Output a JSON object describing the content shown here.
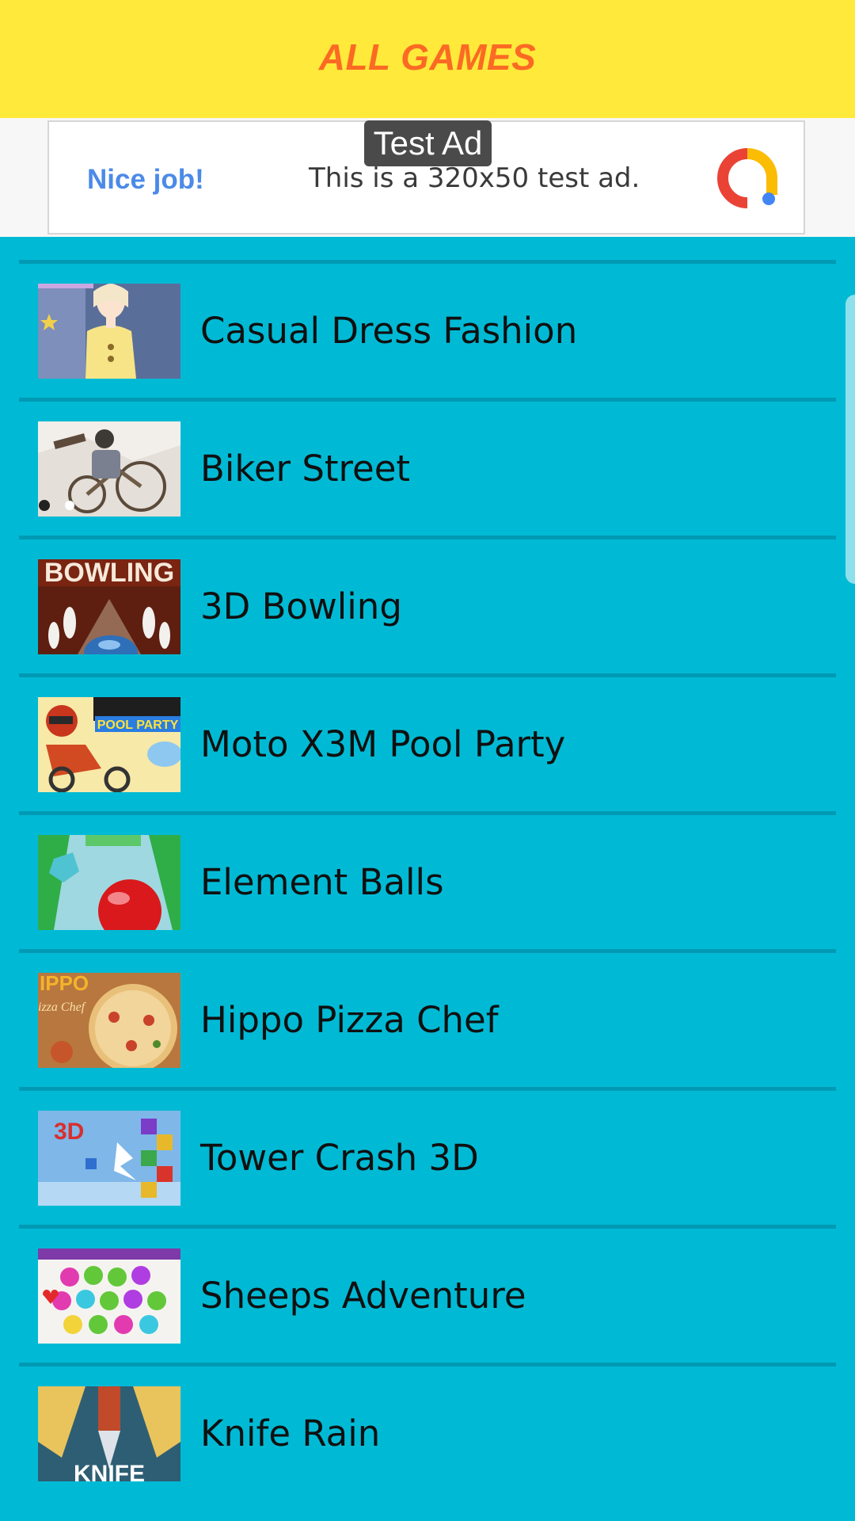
{
  "header": {
    "title": "ALL GAMES"
  },
  "ad": {
    "label": "Test Ad",
    "headline": "Nice job!",
    "text": "This is a 320x50 test ad.",
    "logo_icon": "admob-icon",
    "colors": {
      "headline": "#4B8AE8",
      "logo_red": "#EA4335",
      "logo_yellow": "#FBBC04",
      "logo_blue": "#4285F4"
    }
  },
  "games": [
    {
      "title": "Casual Dress Fashion",
      "thumb_icon": "dress-fashion-thumbnail"
    },
    {
      "title": "Biker Street",
      "thumb_icon": "biker-street-thumbnail"
    },
    {
      "title": "3D Bowling",
      "thumb_icon": "bowling-thumbnail"
    },
    {
      "title": "Moto X3M Pool Party",
      "thumb_icon": "moto-pool-party-thumbnail"
    },
    {
      "title": "Element Balls",
      "thumb_icon": "element-balls-thumbnail"
    },
    {
      "title": "Hippo Pizza Chef",
      "thumb_icon": "pizza-chef-thumbnail"
    },
    {
      "title": "Tower Crash 3D",
      "thumb_icon": "tower-crash-thumbnail"
    },
    {
      "title": "Sheeps Adventure",
      "thumb_icon": "sheeps-adventure-thumbnail"
    },
    {
      "title": "Knife Rain",
      "thumb_icon": "knife-rain-thumbnail"
    }
  ],
  "colors": {
    "header_bg": "#FFE93A",
    "header_text": "#FB6A24",
    "list_bg": "#00BAD5",
    "divider": "#0099B3"
  }
}
